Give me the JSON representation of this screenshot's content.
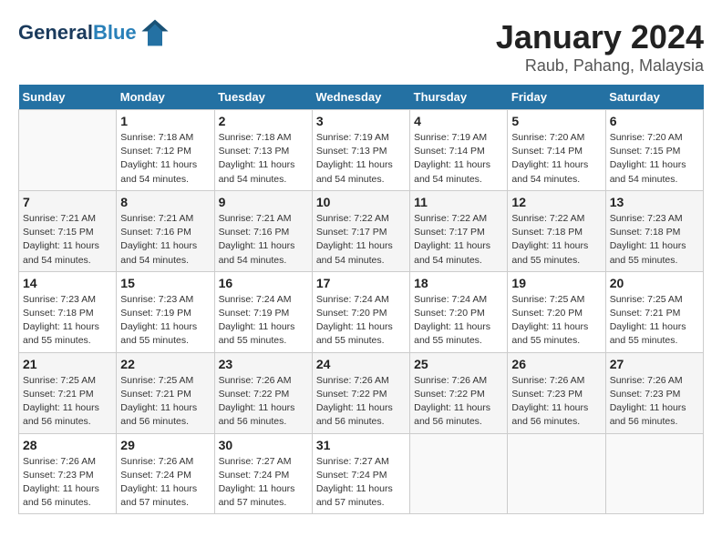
{
  "app": {
    "logo_line1": "General",
    "logo_line2": "Blue"
  },
  "title": "January 2024",
  "subtitle": "Raub, Pahang, Malaysia",
  "days_of_week": [
    "Sunday",
    "Monday",
    "Tuesday",
    "Wednesday",
    "Thursday",
    "Friday",
    "Saturday"
  ],
  "weeks": [
    [
      {
        "day": "",
        "sunrise": "",
        "sunset": "",
        "daylight": ""
      },
      {
        "day": "1",
        "sunrise": "7:18 AM",
        "sunset": "7:12 PM",
        "daylight": "11 hours and 54 minutes."
      },
      {
        "day": "2",
        "sunrise": "7:18 AM",
        "sunset": "7:13 PM",
        "daylight": "11 hours and 54 minutes."
      },
      {
        "day": "3",
        "sunrise": "7:19 AM",
        "sunset": "7:13 PM",
        "daylight": "11 hours and 54 minutes."
      },
      {
        "day": "4",
        "sunrise": "7:19 AM",
        "sunset": "7:14 PM",
        "daylight": "11 hours and 54 minutes."
      },
      {
        "day": "5",
        "sunrise": "7:20 AM",
        "sunset": "7:14 PM",
        "daylight": "11 hours and 54 minutes."
      },
      {
        "day": "6",
        "sunrise": "7:20 AM",
        "sunset": "7:15 PM",
        "daylight": "11 hours and 54 minutes."
      }
    ],
    [
      {
        "day": "7",
        "sunrise": "7:21 AM",
        "sunset": "7:15 PM",
        "daylight": "11 hours and 54 minutes."
      },
      {
        "day": "8",
        "sunrise": "7:21 AM",
        "sunset": "7:16 PM",
        "daylight": "11 hours and 54 minutes."
      },
      {
        "day": "9",
        "sunrise": "7:21 AM",
        "sunset": "7:16 PM",
        "daylight": "11 hours and 54 minutes."
      },
      {
        "day": "10",
        "sunrise": "7:22 AM",
        "sunset": "7:17 PM",
        "daylight": "11 hours and 54 minutes."
      },
      {
        "day": "11",
        "sunrise": "7:22 AM",
        "sunset": "7:17 PM",
        "daylight": "11 hours and 54 minutes."
      },
      {
        "day": "12",
        "sunrise": "7:22 AM",
        "sunset": "7:18 PM",
        "daylight": "11 hours and 55 minutes."
      },
      {
        "day": "13",
        "sunrise": "7:23 AM",
        "sunset": "7:18 PM",
        "daylight": "11 hours and 55 minutes."
      }
    ],
    [
      {
        "day": "14",
        "sunrise": "7:23 AM",
        "sunset": "7:18 PM",
        "daylight": "11 hours and 55 minutes."
      },
      {
        "day": "15",
        "sunrise": "7:23 AM",
        "sunset": "7:19 PM",
        "daylight": "11 hours and 55 minutes."
      },
      {
        "day": "16",
        "sunrise": "7:24 AM",
        "sunset": "7:19 PM",
        "daylight": "11 hours and 55 minutes."
      },
      {
        "day": "17",
        "sunrise": "7:24 AM",
        "sunset": "7:20 PM",
        "daylight": "11 hours and 55 minutes."
      },
      {
        "day": "18",
        "sunrise": "7:24 AM",
        "sunset": "7:20 PM",
        "daylight": "11 hours and 55 minutes."
      },
      {
        "day": "19",
        "sunrise": "7:25 AM",
        "sunset": "7:20 PM",
        "daylight": "11 hours and 55 minutes."
      },
      {
        "day": "20",
        "sunrise": "7:25 AM",
        "sunset": "7:21 PM",
        "daylight": "11 hours and 55 minutes."
      }
    ],
    [
      {
        "day": "21",
        "sunrise": "7:25 AM",
        "sunset": "7:21 PM",
        "daylight": "11 hours and 56 minutes."
      },
      {
        "day": "22",
        "sunrise": "7:25 AM",
        "sunset": "7:21 PM",
        "daylight": "11 hours and 56 minutes."
      },
      {
        "day": "23",
        "sunrise": "7:26 AM",
        "sunset": "7:22 PM",
        "daylight": "11 hours and 56 minutes."
      },
      {
        "day": "24",
        "sunrise": "7:26 AM",
        "sunset": "7:22 PM",
        "daylight": "11 hours and 56 minutes."
      },
      {
        "day": "25",
        "sunrise": "7:26 AM",
        "sunset": "7:22 PM",
        "daylight": "11 hours and 56 minutes."
      },
      {
        "day": "26",
        "sunrise": "7:26 AM",
        "sunset": "7:23 PM",
        "daylight": "11 hours and 56 minutes."
      },
      {
        "day": "27",
        "sunrise": "7:26 AM",
        "sunset": "7:23 PM",
        "daylight": "11 hours and 56 minutes."
      }
    ],
    [
      {
        "day": "28",
        "sunrise": "7:26 AM",
        "sunset": "7:23 PM",
        "daylight": "11 hours and 56 minutes."
      },
      {
        "day": "29",
        "sunrise": "7:26 AM",
        "sunset": "7:24 PM",
        "daylight": "11 hours and 57 minutes."
      },
      {
        "day": "30",
        "sunrise": "7:27 AM",
        "sunset": "7:24 PM",
        "daylight": "11 hours and 57 minutes."
      },
      {
        "day": "31",
        "sunrise": "7:27 AM",
        "sunset": "7:24 PM",
        "daylight": "11 hours and 57 minutes."
      },
      {
        "day": "",
        "sunrise": "",
        "sunset": "",
        "daylight": ""
      },
      {
        "day": "",
        "sunrise": "",
        "sunset": "",
        "daylight": ""
      },
      {
        "day": "",
        "sunrise": "",
        "sunset": "",
        "daylight": ""
      }
    ]
  ],
  "labels": {
    "sunrise": "Sunrise:",
    "sunset": "Sunset:",
    "daylight": "Daylight:"
  }
}
